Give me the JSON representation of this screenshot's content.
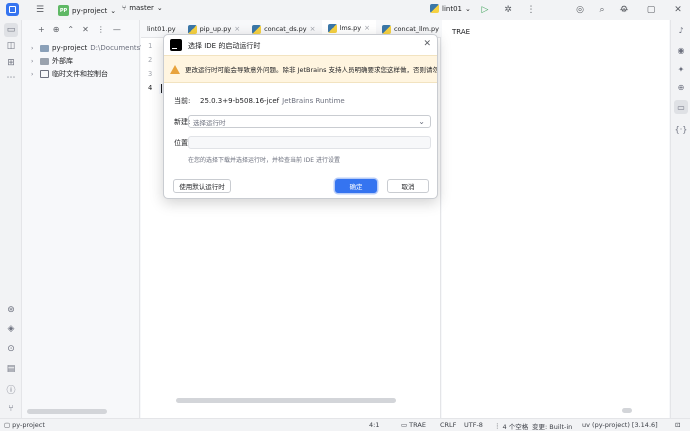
{
  "titlebar": {
    "project_badge": "PP",
    "project_name": "py-project",
    "branch": "master",
    "run_config": "lint01",
    "icons": [
      "menu-icon",
      "branch-icon",
      "run-icon",
      "debug-icon",
      "more-icon",
      "copilot-icon",
      "search-icon",
      "settings-icon"
    ]
  },
  "project_pane": {
    "tree": [
      {
        "label": "py-project",
        "path": "D:\\Documents\\Pyth"
      },
      {
        "label": "外部库"
      },
      {
        "label": "临时文件和控制台"
      }
    ]
  },
  "editor": {
    "tabs": [
      "lint01.py",
      "pip_up.py",
      "concat_ds.py",
      "lms.py",
      "concat_llm.py"
    ],
    "active_tab": 3,
    "line_numbers": [
      "1",
      "2",
      "3",
      "4"
    ]
  },
  "right_pane": {
    "text": "TRAE"
  },
  "dialog": {
    "title": "选择 IDE 的启动运行时",
    "warning": "更改运行时可能会导致意外问题。除非 JetBrains 支持人员明确要求您这样做，否则请勿进行更改。",
    "current_label": "当前:",
    "current_value": "25.0.3+9-b508.16-jcef",
    "current_suffix": "JetBrains Runtime",
    "new_label": "新建:",
    "new_placeholder": "选择运行时",
    "location_label": "位置:",
    "hint": "在您的选择下载并选择运行时，并检查当前 IDE 进行设置",
    "default_button": "使用默认运行时",
    "ok_button": "确定",
    "cancel_button": "取消"
  },
  "statusbar": {
    "project": "py-project",
    "position": "4:1",
    "trae": "TRAE",
    "line_sep": "CRLF",
    "encoding": "UTF-8",
    "indent": "4 个空格",
    "vcs": "变更: Built-in",
    "interpreter": "uv (py-project) [3.14.6]"
  },
  "colors": {
    "accent": "#3574f0",
    "warning_bg": "#fff5e0",
    "warning_icon": "#e8a33d"
  }
}
